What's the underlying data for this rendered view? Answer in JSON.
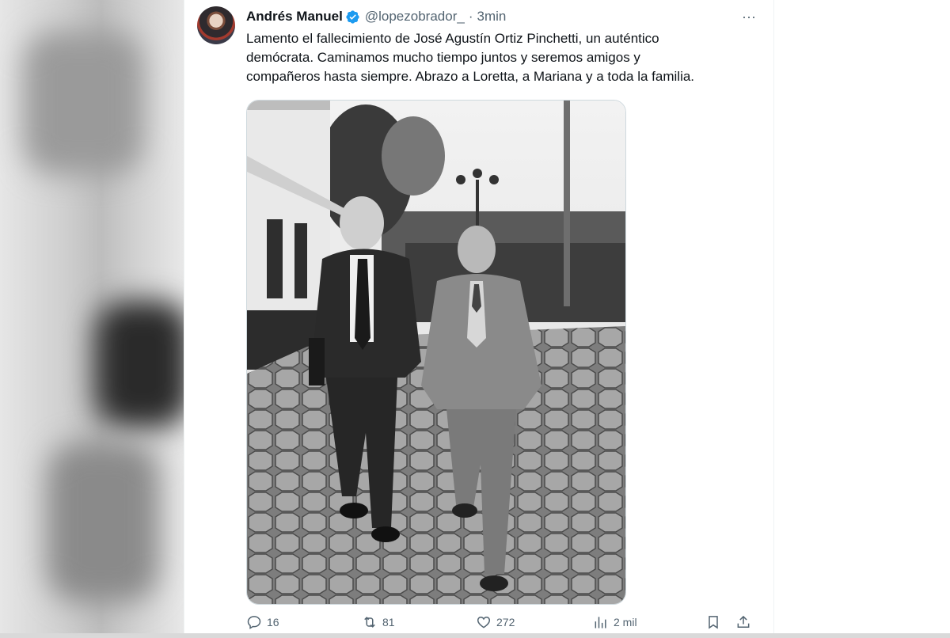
{
  "tweet": {
    "author_name": "Andrés Manuel",
    "handle": "@lopezobrador_",
    "separator": "·",
    "time": "3min",
    "text": "Lamento el fallecimiento de José Agustín Ortiz Pinchetti, un auténtico\ndemócrata. Caminamos mucho tiempo juntos y seremos amigos y\ncompañeros hasta siempre. Abrazo a Loretta, a Mariana y a toda la familia.",
    "more_label": "···",
    "verified_color": "#1d9bf0"
  },
  "actions": {
    "replies": "16",
    "reposts": "81",
    "likes": "272",
    "views": "2 mil"
  },
  "colors": {
    "text_primary": "#0f1419",
    "text_secondary": "#536471",
    "border": "#cfd9de"
  }
}
